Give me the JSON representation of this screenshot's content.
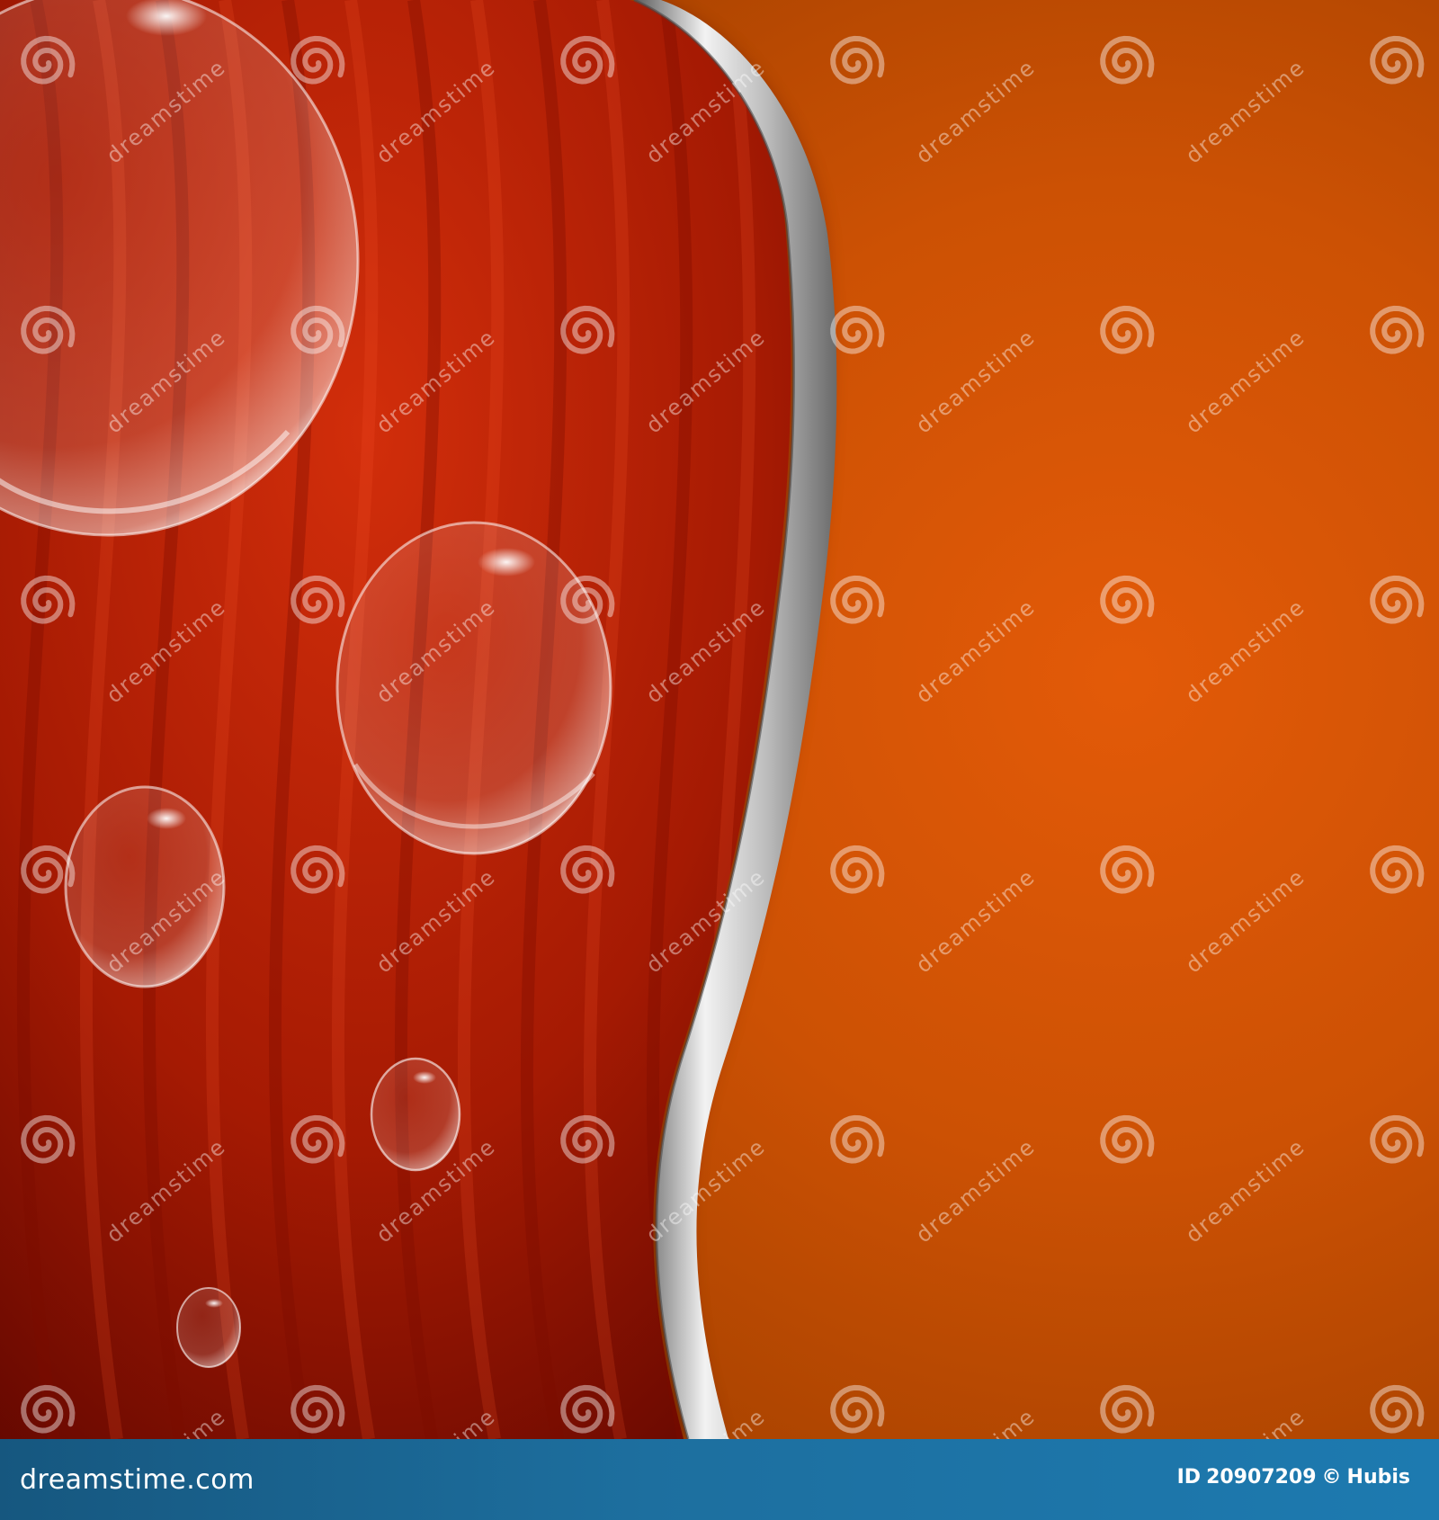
{
  "image": {
    "description_colors": {
      "orange_center": "#e35a08",
      "orange_edge": "#a94300",
      "red_light": "#d22e0b",
      "red_dark": "#5a0500",
      "metal_light": "#f2f2f2",
      "metal_dark": "#5b5b5b",
      "footer_bar": "#1d6f9f"
    },
    "watermark": {
      "text": "dreamstime"
    },
    "footer": {
      "site": "dreamstime.com",
      "id_label": "ID",
      "id_value": "20907209",
      "copyright_symbol": "©",
      "author": "Hubis"
    }
  }
}
